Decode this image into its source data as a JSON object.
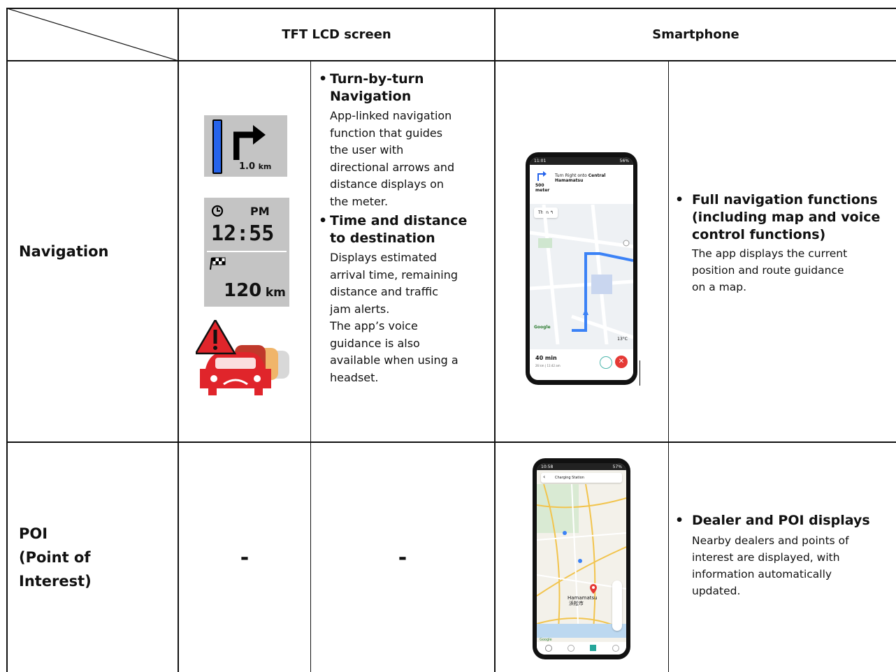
{
  "header": {
    "tft": "TFT LCD screen",
    "smartphone": "Smartphone"
  },
  "rows": {
    "navigation": {
      "label": "Navigation",
      "tft": {
        "distance_value": "1.0",
        "distance_unit": "km",
        "clock_period": "PM",
        "clock_time": "12:55",
        "remaining_value": "120",
        "remaining_unit": "km",
        "bullet1_title_1": "Turn-by-turn",
        "bullet1_title_2": "Navigation",
        "bullet1_desc": [
          "App-linked navigation",
          "function that guides",
          "the user with",
          "directional arrows and",
          "distance displays on",
          "the meter."
        ],
        "bullet2_title_1": "Time and distance",
        "bullet2_title_2": "to destination",
        "bullet2_desc": [
          "Displays estimated",
          "arrival time, remaining",
          "distance and traffic",
          "jam alerts.",
          "The app’s voice",
          "guidance is also",
          "available when using a",
          "headset."
        ]
      },
      "smartphone": {
        "phone": {
          "status_time": "11:01",
          "status_right": "56%",
          "turn_text": "Turn Right onto",
          "turn_street_1": "Central",
          "turn_street_2": "Hamamatsu",
          "turn_distance_1": "500",
          "turn_distance_2": "meter",
          "then_label": "Then",
          "weather": "13°C",
          "google_label": "Google",
          "eta": "40 min",
          "eta_sub": "26 km | 11:42 am"
        },
        "bullet_title": [
          "Full navigation functions",
          "(including map and voice",
          "control functions)"
        ],
        "bullet_desc": [
          "The app displays the current",
          "position and route guidance",
          "on a map."
        ]
      }
    },
    "poi": {
      "label_1": "POI",
      "label_2": "(Point of",
      "label_3": "Interest)",
      "tft_col1": "-",
      "tft_col2": "-",
      "smartphone": {
        "phone": {
          "status_time": "10:58",
          "status_right": "57%",
          "search_text": "Charging Station",
          "city_en": "Hamamatsu",
          "city_jp": "浜松市",
          "google_label": "Google"
        },
        "bullet_title": "Dealer and POI displays",
        "bullet_desc": [
          "Nearby dealers and points of",
          "interest are displayed, with",
          "information automatically",
          "updated."
        ]
      }
    }
  },
  "colors": {
    "border": "#111111",
    "tft_panel": "#c4c4c4",
    "meter_blue": "#2563eb",
    "warning_red": "#e0252b",
    "route_blue": "#3b82f6",
    "cancel_red": "#e53935"
  }
}
